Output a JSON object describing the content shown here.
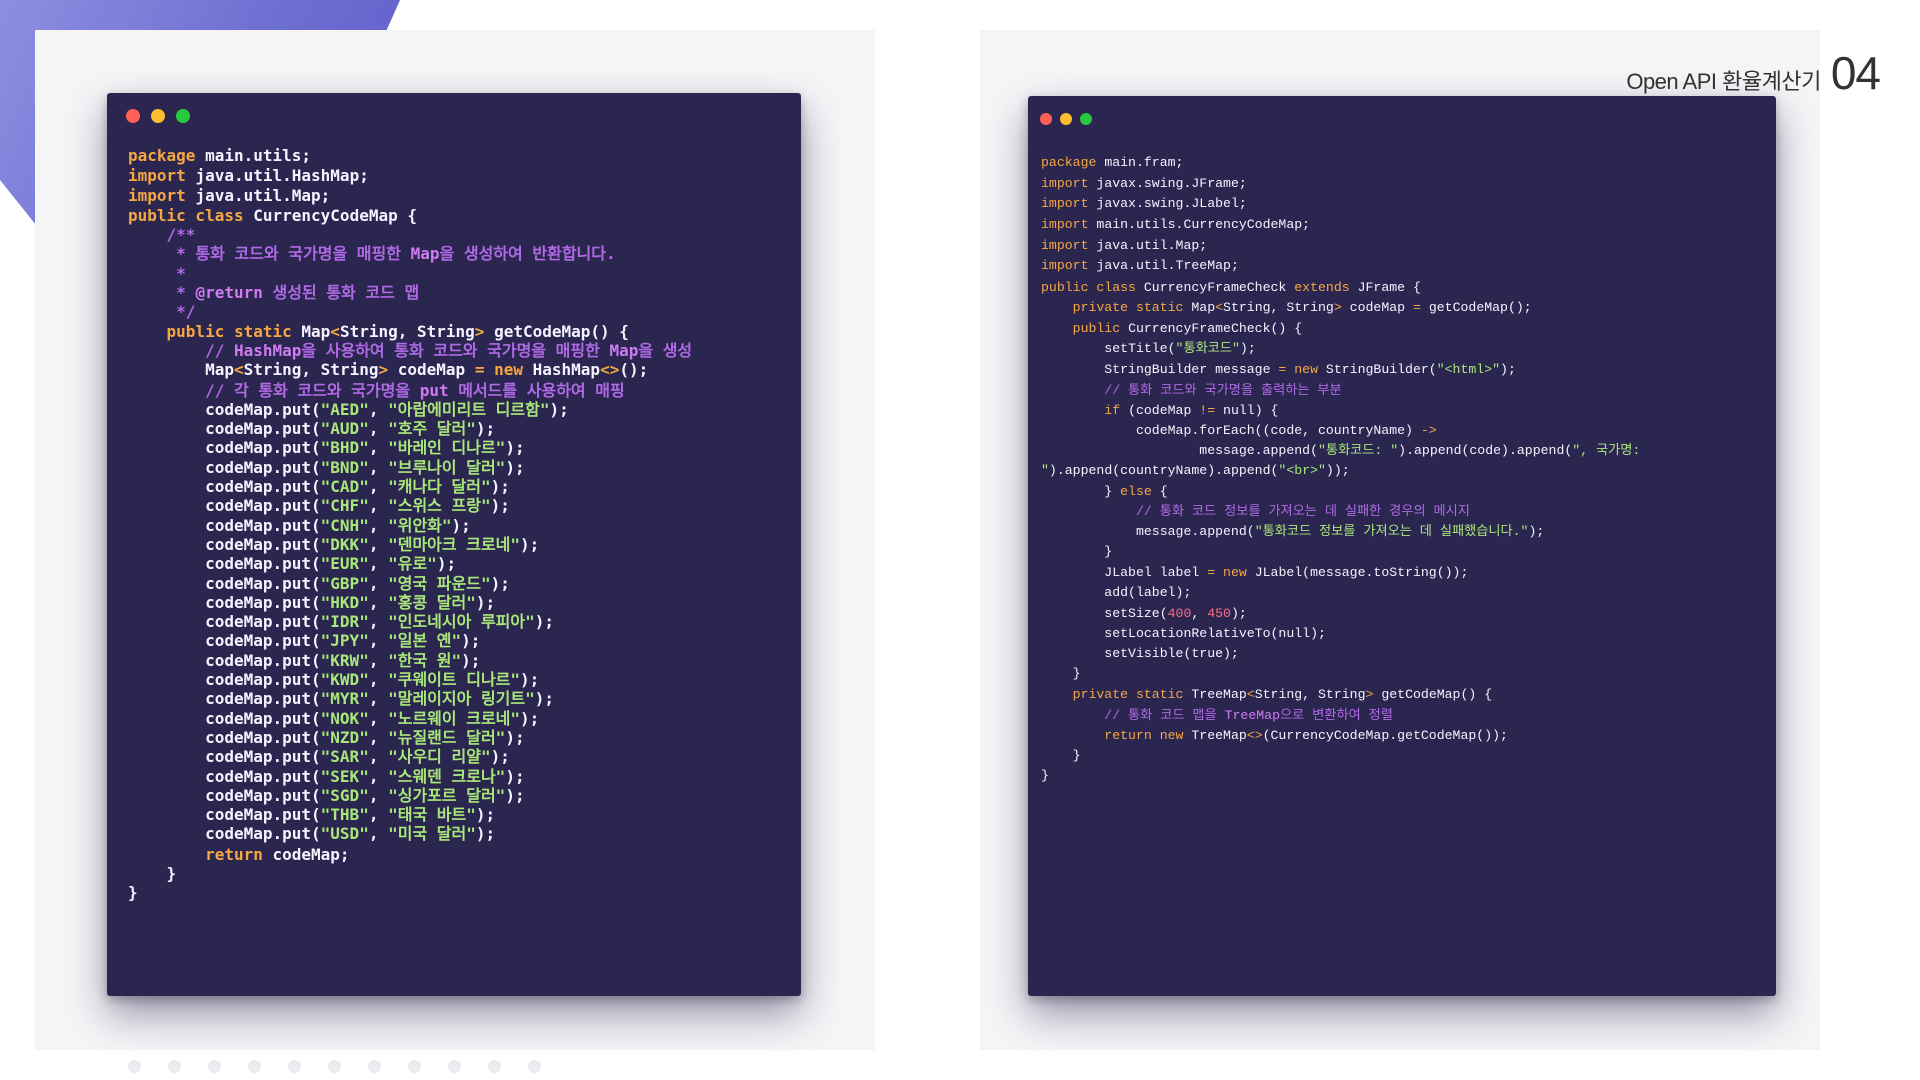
{
  "header": {
    "title": "Open API 환율계산기",
    "page_number": "04"
  },
  "colors": {
    "window_bg": "#2b2650",
    "keyword": "#f5a742",
    "text": "#f5f3ff",
    "string": "#a9e77a",
    "comment": "#b06ae6",
    "number": "#ff6b82",
    "accent_shape": "#6e6fd2",
    "dot_red": "#ff5f57",
    "dot_yellow": "#febc2e",
    "dot_green": "#28c840"
  },
  "windows": [
    {
      "name": "currency-code-map-source",
      "lines": [
        [],
        [
          [
            "kw",
            "package "
          ],
          [
            "tx",
            "main.utils;"
          ]
        ],
        [],
        [
          [
            "kw",
            "import "
          ],
          [
            "tx",
            "java.util.HashMap;"
          ]
        ],
        [
          [
            "kw",
            "import "
          ],
          [
            "tx",
            "java.util.Map;"
          ]
        ],
        [],
        [
          [
            "kw",
            "public class "
          ],
          [
            "tx",
            "CurrencyCodeMap {"
          ]
        ],
        [
          [
            "cm",
            "    /**"
          ]
        ],
        [
          [
            "cm",
            "     * 통화 코드와 국가명을 매핑한 "
          ],
          [
            "at",
            "Map"
          ],
          [
            "cm",
            "을 생성하여 반환합니다."
          ]
        ],
        [
          [
            "cm",
            "     *"
          ]
        ],
        [
          [
            "cm",
            "     * "
          ],
          [
            "at",
            "@return"
          ],
          [
            "cm",
            " 생성된 통화 코드 맵"
          ]
        ],
        [
          [
            "cm",
            "     */"
          ]
        ],
        [
          [
            "kw",
            "    public static "
          ],
          [
            "tx",
            "Map"
          ],
          [
            "op",
            "<"
          ],
          [
            "tx",
            "String, String"
          ],
          [
            "op",
            ">"
          ],
          [
            "tx",
            " getCodeMap() {"
          ]
        ],
        [
          [
            "cm",
            "        // "
          ],
          [
            "at",
            "HashMap"
          ],
          [
            "cm",
            "을 사용하여 통화 코드와 국가명을 매핑한 "
          ],
          [
            "at",
            "Map"
          ],
          [
            "cm",
            "을 생성"
          ]
        ],
        [
          [
            "tx",
            "        Map"
          ],
          [
            "op",
            "<"
          ],
          [
            "tx",
            "String, String"
          ],
          [
            "op",
            ">"
          ],
          [
            "tx",
            " codeMap "
          ],
          [
            "op",
            "="
          ],
          [
            "kw",
            " new "
          ],
          [
            "tx",
            "HashMap"
          ],
          [
            "op",
            "<>"
          ],
          [
            "tx",
            "();"
          ]
        ],
        [],
        [
          [
            "cm",
            "        // 각 통화 코드와 국가명을 "
          ],
          [
            "at",
            "put"
          ],
          [
            "cm",
            " 메서드를 사용하여 매핑"
          ]
        ],
        [
          [
            "tx",
            "        codeMap.put("
          ],
          [
            "str",
            "\"AED\""
          ],
          [
            "tx",
            ", "
          ],
          [
            "str",
            "\"아랍에미리트 디르함\""
          ],
          [
            "tx",
            ");"
          ]
        ],
        [
          [
            "tx",
            "        codeMap.put("
          ],
          [
            "str",
            "\"AUD\""
          ],
          [
            "tx",
            ", "
          ],
          [
            "str",
            "\"호주 달러\""
          ],
          [
            "tx",
            ");"
          ]
        ],
        [
          [
            "tx",
            "        codeMap.put("
          ],
          [
            "str",
            "\"BHD\""
          ],
          [
            "tx",
            ", "
          ],
          [
            "str",
            "\"바레인 디나르\""
          ],
          [
            "tx",
            ");"
          ]
        ],
        [
          [
            "tx",
            "        codeMap.put("
          ],
          [
            "str",
            "\"BND\""
          ],
          [
            "tx",
            ", "
          ],
          [
            "str",
            "\"브루나이 달러\""
          ],
          [
            "tx",
            ");"
          ]
        ],
        [
          [
            "tx",
            "        codeMap.put("
          ],
          [
            "str",
            "\"CAD\""
          ],
          [
            "tx",
            ", "
          ],
          [
            "str",
            "\"캐나다 달러\""
          ],
          [
            "tx",
            ");"
          ]
        ],
        [
          [
            "tx",
            "        codeMap.put("
          ],
          [
            "str",
            "\"CHF\""
          ],
          [
            "tx",
            ", "
          ],
          [
            "str",
            "\"스위스 프랑\""
          ],
          [
            "tx",
            ");"
          ]
        ],
        [
          [
            "tx",
            "        codeMap.put("
          ],
          [
            "str",
            "\"CNH\""
          ],
          [
            "tx",
            ", "
          ],
          [
            "str",
            "\"위안화\""
          ],
          [
            "tx",
            ");"
          ]
        ],
        [
          [
            "tx",
            "        codeMap.put("
          ],
          [
            "str",
            "\"DKK\""
          ],
          [
            "tx",
            ", "
          ],
          [
            "str",
            "\"덴마아크 크로네\""
          ],
          [
            "tx",
            ");"
          ]
        ],
        [
          [
            "tx",
            "        codeMap.put("
          ],
          [
            "str",
            "\"EUR\""
          ],
          [
            "tx",
            ", "
          ],
          [
            "str",
            "\"유로\""
          ],
          [
            "tx",
            ");"
          ]
        ],
        [
          [
            "tx",
            "        codeMap.put("
          ],
          [
            "str",
            "\"GBP\""
          ],
          [
            "tx",
            ", "
          ],
          [
            "str",
            "\"영국 파운드\""
          ],
          [
            "tx",
            ");"
          ]
        ],
        [
          [
            "tx",
            "        codeMap.put("
          ],
          [
            "str",
            "\"HKD\""
          ],
          [
            "tx",
            ", "
          ],
          [
            "str",
            "\"홍콩 달러\""
          ],
          [
            "tx",
            ");"
          ]
        ],
        [
          [
            "tx",
            "        codeMap.put("
          ],
          [
            "str",
            "\"IDR\""
          ],
          [
            "tx",
            ", "
          ],
          [
            "str",
            "\"인도네시아 루피아\""
          ],
          [
            "tx",
            ");"
          ]
        ],
        [
          [
            "tx",
            "        codeMap.put("
          ],
          [
            "str",
            "\"JPY\""
          ],
          [
            "tx",
            ", "
          ],
          [
            "str",
            "\"일본 옌\""
          ],
          [
            "tx",
            ");"
          ]
        ],
        [
          [
            "tx",
            "        codeMap.put("
          ],
          [
            "str",
            "\"KRW\""
          ],
          [
            "tx",
            ", "
          ],
          [
            "str",
            "\"한국 원\""
          ],
          [
            "tx",
            ");"
          ]
        ],
        [
          [
            "tx",
            "        codeMap.put("
          ],
          [
            "str",
            "\"KWD\""
          ],
          [
            "tx",
            ", "
          ],
          [
            "str",
            "\"쿠웨이트 디나르\""
          ],
          [
            "tx",
            ");"
          ]
        ],
        [
          [
            "tx",
            "        codeMap.put("
          ],
          [
            "str",
            "\"MYR\""
          ],
          [
            "tx",
            ", "
          ],
          [
            "str",
            "\"말레이지아 링기트\""
          ],
          [
            "tx",
            ");"
          ]
        ],
        [
          [
            "tx",
            "        codeMap.put("
          ],
          [
            "str",
            "\"NOK\""
          ],
          [
            "tx",
            ", "
          ],
          [
            "str",
            "\"노르웨이 크로네\""
          ],
          [
            "tx",
            ");"
          ]
        ],
        [
          [
            "tx",
            "        codeMap.put("
          ],
          [
            "str",
            "\"NZD\""
          ],
          [
            "tx",
            ", "
          ],
          [
            "str",
            "\"뉴질랜드 달러\""
          ],
          [
            "tx",
            ");"
          ]
        ],
        [
          [
            "tx",
            "        codeMap.put("
          ],
          [
            "str",
            "\"SAR\""
          ],
          [
            "tx",
            ", "
          ],
          [
            "str",
            "\"사우디 리얄\""
          ],
          [
            "tx",
            ");"
          ]
        ],
        [
          [
            "tx",
            "        codeMap.put("
          ],
          [
            "str",
            "\"SEK\""
          ],
          [
            "tx",
            ", "
          ],
          [
            "str",
            "\"스웨덴 크로나\""
          ],
          [
            "tx",
            ");"
          ]
        ],
        [
          [
            "tx",
            "        codeMap.put("
          ],
          [
            "str",
            "\"SGD\""
          ],
          [
            "tx",
            ", "
          ],
          [
            "str",
            "\"싱가포르 달러\""
          ],
          [
            "tx",
            ");"
          ]
        ],
        [
          [
            "tx",
            "        codeMap.put("
          ],
          [
            "str",
            "\"THB\""
          ],
          [
            "tx",
            ", "
          ],
          [
            "str",
            "\"태국 바트\""
          ],
          [
            "tx",
            ");"
          ]
        ],
        [
          [
            "tx",
            "        codeMap.put("
          ],
          [
            "str",
            "\"USD\""
          ],
          [
            "tx",
            ", "
          ],
          [
            "str",
            "\"미국 달러\""
          ],
          [
            "tx",
            ");"
          ]
        ],
        [],
        [
          [
            "kw",
            "        return "
          ],
          [
            "tx",
            "codeMap;"
          ]
        ],
        [
          [
            "tx",
            "    }"
          ]
        ],
        [
          [
            "tx",
            "}"
          ]
        ]
      ]
    },
    {
      "name": "currency-frame-check-source",
      "lines": [
        [
          [
            "kw",
            "package "
          ],
          [
            "tx",
            "main.fram;"
          ]
        ],
        [],
        [
          [
            "kw",
            "import "
          ],
          [
            "tx",
            "javax.swing.JFrame;"
          ]
        ],
        [
          [
            "kw",
            "import "
          ],
          [
            "tx",
            "javax.swing.JLabel;"
          ]
        ],
        [],
        [
          [
            "kw",
            "import "
          ],
          [
            "tx",
            "main.utils.CurrencyCodeMap;"
          ]
        ],
        [],
        [
          [
            "kw",
            "import "
          ],
          [
            "tx",
            "java.util.Map;"
          ]
        ],
        [
          [
            "kw",
            "import "
          ],
          [
            "tx",
            "java.util.TreeMap;"
          ]
        ],
        [],
        [
          [
            "kw",
            "public class "
          ],
          [
            "tx",
            "CurrencyFrameCheck "
          ],
          [
            "kw",
            "extends "
          ],
          [
            "tx",
            "JFrame {"
          ]
        ],
        [
          [
            "kw",
            "    private static "
          ],
          [
            "tx",
            "Map"
          ],
          [
            "op",
            "<"
          ],
          [
            "tx",
            "String, String"
          ],
          [
            "op",
            ">"
          ],
          [
            "tx",
            " codeMap "
          ],
          [
            "op",
            "="
          ],
          [
            "tx",
            " getCodeMap();"
          ]
        ],
        [],
        [
          [
            "kw",
            "    public "
          ],
          [
            "tx",
            "CurrencyFrameCheck() {"
          ]
        ],
        [
          [
            "tx",
            "        setTitle("
          ],
          [
            "str",
            "\"통화코드\""
          ],
          [
            "tx",
            ");"
          ]
        ],
        [],
        [
          [
            "tx",
            "        StringBuilder message "
          ],
          [
            "op",
            "="
          ],
          [
            "kw",
            " new "
          ],
          [
            "tx",
            "StringBuilder("
          ],
          [
            "str",
            "\"<html>\""
          ],
          [
            "tx",
            ");"
          ]
        ],
        [],
        [
          [
            "cm",
            "        // 통화 코드와 국가명을 출력하는 부분"
          ]
        ],
        [
          [
            "kw",
            "        if "
          ],
          [
            "tx",
            "(codeMap "
          ],
          [
            "op",
            "!="
          ],
          [
            "tx",
            " null) {"
          ]
        ],
        [
          [
            "tx",
            "            codeMap.forEach((code, countryName) "
          ],
          [
            "op",
            "->"
          ]
        ],
        [
          [
            "tx",
            "                    message.append("
          ],
          [
            "str",
            "\"통화코드: \""
          ],
          [
            "tx",
            ").append(code).append("
          ],
          [
            "str",
            "\", 국가명:"
          ]
        ],
        [
          [
            "str",
            "\""
          ],
          [
            "tx",
            ").append(countryName).append("
          ],
          [
            "str",
            "\"<br>\""
          ],
          [
            "tx",
            "));"
          ]
        ],
        [
          [
            "tx",
            "        } "
          ],
          [
            "kw",
            "else"
          ],
          [
            "tx",
            " {"
          ]
        ],
        [
          [
            "cm",
            "            // 통화 코드 정보를 가져오는 데 실패한 경우의 메시지"
          ]
        ],
        [
          [
            "tx",
            "            message.append("
          ],
          [
            "str",
            "\"통화코드 정보를 가져오는 데 실패했습니다.\""
          ],
          [
            "tx",
            ");"
          ]
        ],
        [
          [
            "tx",
            "        }"
          ]
        ],
        [],
        [
          [
            "tx",
            "        JLabel label "
          ],
          [
            "op",
            "="
          ],
          [
            "kw",
            " new "
          ],
          [
            "tx",
            "JLabel(message.toString());"
          ]
        ],
        [
          [
            "tx",
            "        add(label);"
          ]
        ],
        [],
        [
          [
            "tx",
            "        setSize("
          ],
          [
            "num",
            "400"
          ],
          [
            "tx",
            ", "
          ],
          [
            "num",
            "450"
          ],
          [
            "tx",
            ");"
          ]
        ],
        [
          [
            "tx",
            "        setLocationRelativeTo(null);"
          ]
        ],
        [
          [
            "tx",
            "        setVisible(true);"
          ]
        ],
        [
          [
            "tx",
            "    }"
          ]
        ],
        [],
        [
          [
            "kw",
            "    private static "
          ],
          [
            "tx",
            "TreeMap"
          ],
          [
            "op",
            "<"
          ],
          [
            "tx",
            "String, String"
          ],
          [
            "op",
            ">"
          ],
          [
            "tx",
            " getCodeMap() {"
          ]
        ],
        [
          [
            "cm",
            "        // 통화 코드 맵을 "
          ],
          [
            "at",
            "TreeMap"
          ],
          [
            "cm",
            "으로 변환하여 정렬"
          ]
        ],
        [
          [
            "kw",
            "        return new "
          ],
          [
            "tx",
            "TreeMap"
          ],
          [
            "op",
            "<>"
          ],
          [
            "tx",
            "(CurrencyCodeMap.getCodeMap());"
          ]
        ],
        [
          [
            "tx",
            "    }"
          ]
        ],
        [
          [
            "tx",
            "}"
          ]
        ]
      ]
    }
  ]
}
